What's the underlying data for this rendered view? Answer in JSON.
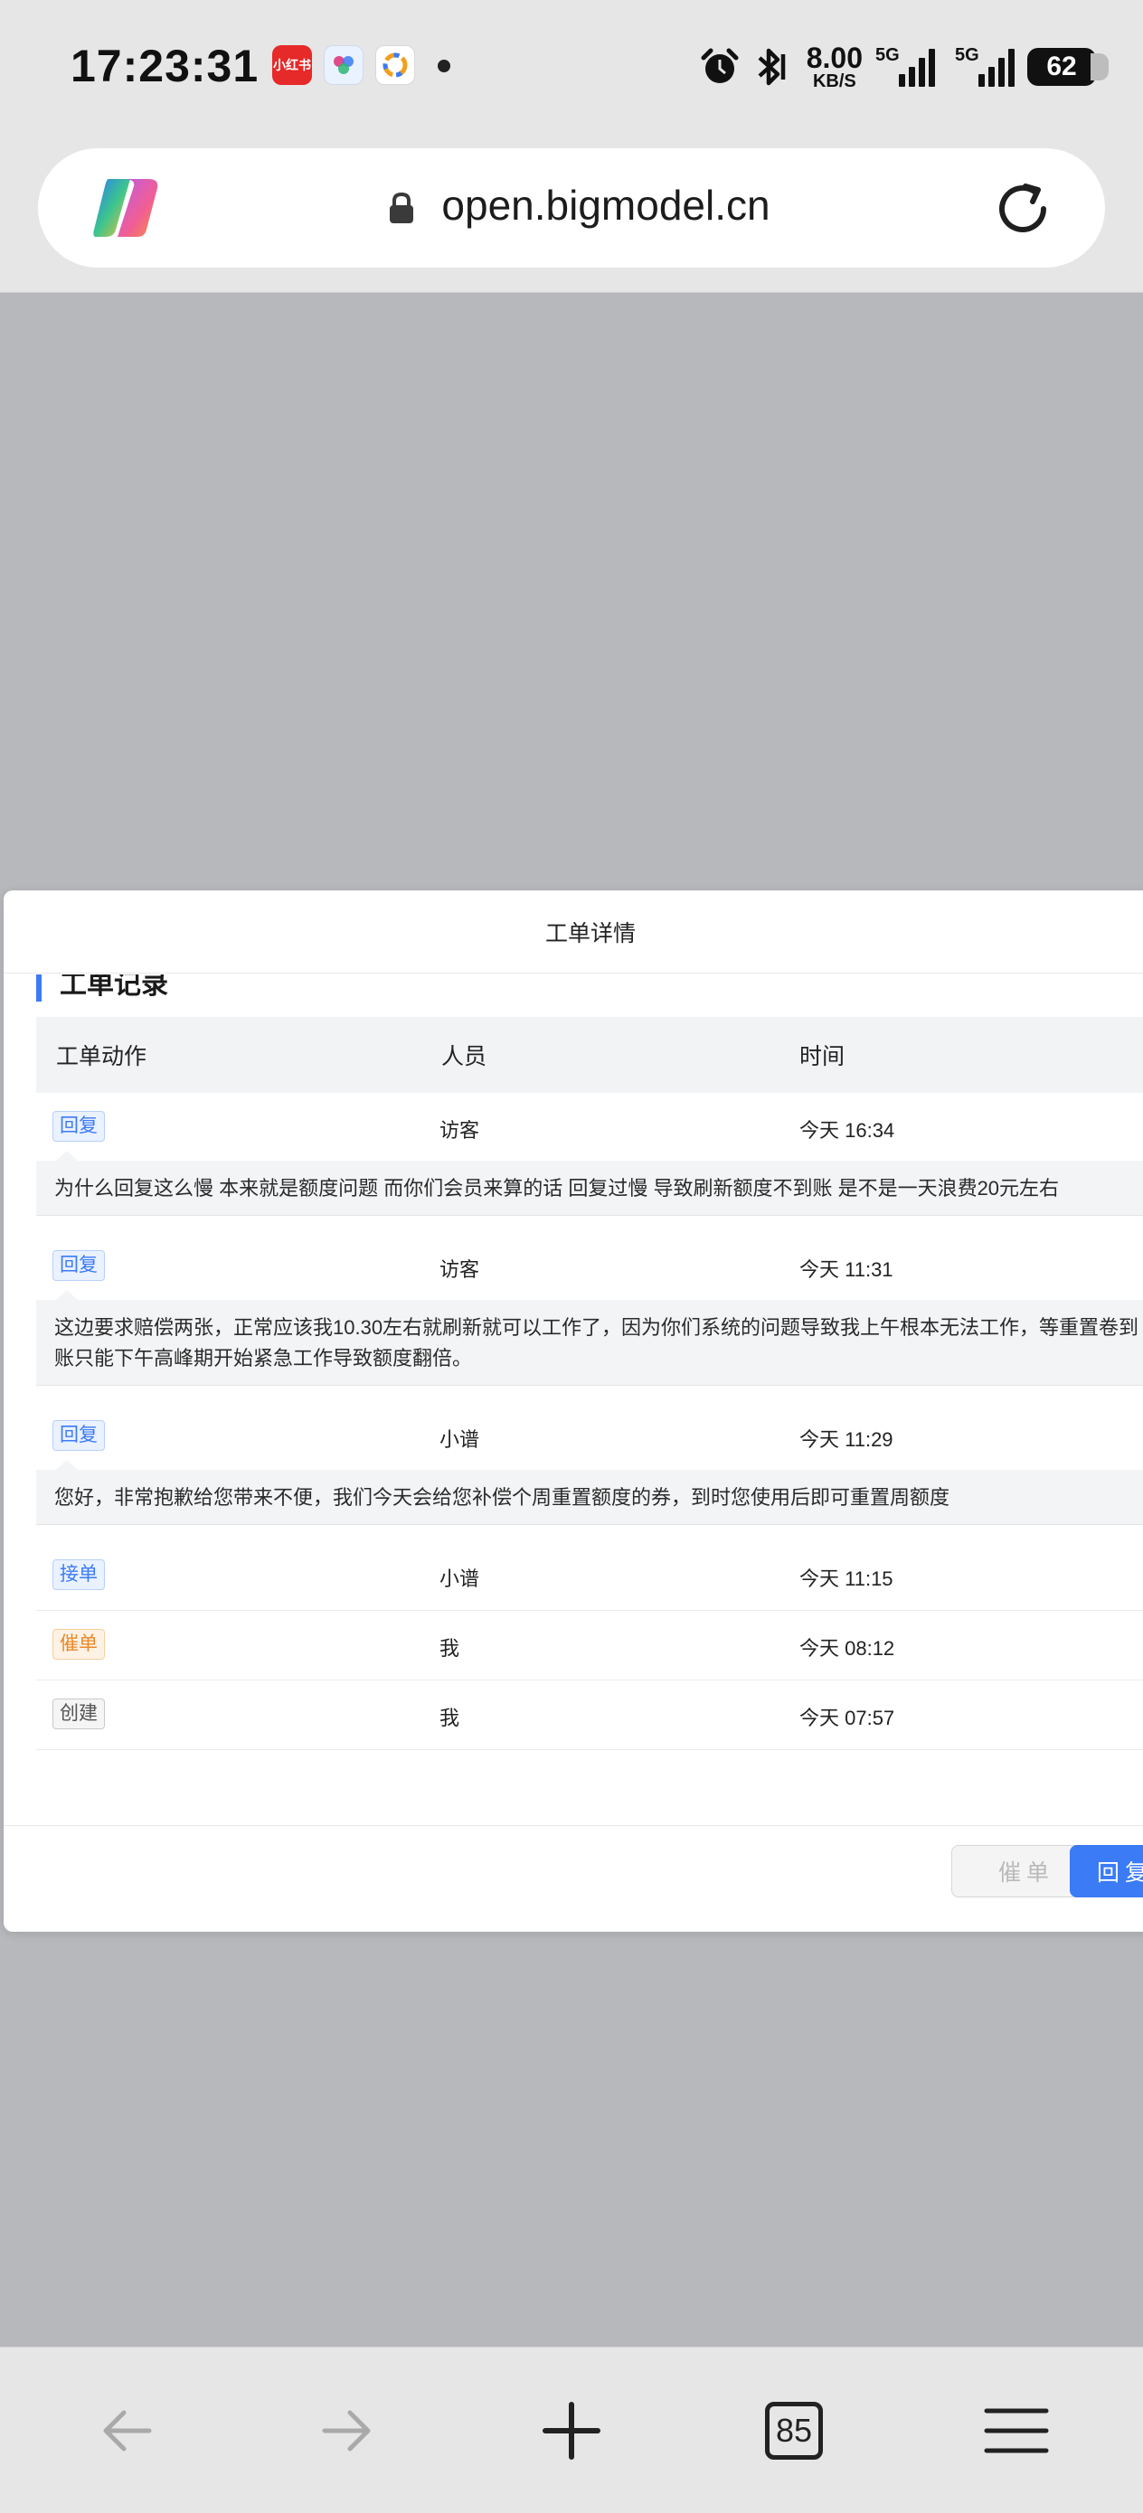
{
  "status_bar": {
    "time": "17:23:31",
    "app_icons": [
      "小红书",
      "CoinFlow",
      "app"
    ],
    "net_speed_value": "8.00",
    "net_speed_unit": "KB/S",
    "signal1_label": "5G",
    "signal2_label": "5G",
    "battery": "62"
  },
  "browser": {
    "url": "open.bigmodel.cn",
    "tab_count": "85"
  },
  "modal": {
    "title": "工单详情",
    "section_heading": "工单记录",
    "columns": [
      "工单动作",
      "人员",
      "时间"
    ],
    "rows": [
      {
        "action": "回复",
        "person": "访客",
        "time": "今天 16:34",
        "message": "为什么回复这么慢 本来就是额度问题 而你们会员来算的话 回复过慢 导致刷新额度不到账 是不是一天浪费20元左右"
      },
      {
        "action": "回复",
        "person": "访客",
        "time": "今天 11:31",
        "message": "这边要求赔偿两张，正常应该我10.30左右就刷新就可以工作了，因为你们系统的问题导致我上午根本无法工作，等重置卷到账只能下午高峰期开始紧急工作导致额度翻倍。"
      },
      {
        "action": "回复",
        "person": "小谱",
        "time": "今天 11:29",
        "message": "您好，非常抱歉给您带来不便，我们今天会给您补偿个周重置额度的券，到时您使用后即可重置周额度"
      },
      {
        "action": "接单",
        "person": "小谱",
        "time": "今天 11:15"
      },
      {
        "action": "催单",
        "person": "我",
        "time": "今天 08:12"
      },
      {
        "action": "创建",
        "person": "我",
        "time": "今天 07:57"
      }
    ],
    "urge_button": "催单",
    "reply_button": "回复"
  },
  "colors": {
    "accent": "#3b7bf6",
    "urge_tag": "#e9892a",
    "backdrop": "#b7b8bb"
  }
}
